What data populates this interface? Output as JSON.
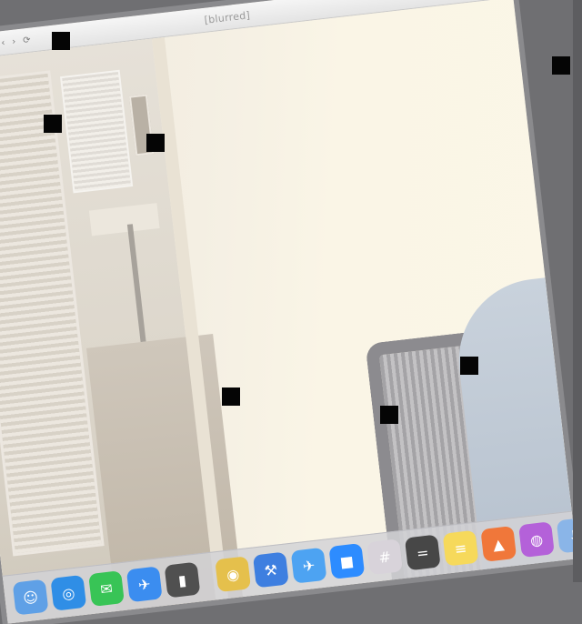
{
  "window": {
    "title": "[blurred]",
    "controls": [
      "‹",
      "›",
      "⟳"
    ]
  },
  "dock": {
    "items": [
      {
        "name": "finder-icon",
        "glyph": "☺",
        "color": "#5fa0e6"
      },
      {
        "name": "safari-icon",
        "glyph": "◎",
        "color": "#2f8ee6"
      },
      {
        "name": "messages-icon",
        "glyph": "✉",
        "color": "#38c456"
      },
      {
        "name": "mail-icon",
        "glyph": "✈",
        "color": "#3b8df0"
      },
      {
        "name": "terminal-icon",
        "glyph": "▮",
        "color": "#505050"
      },
      {
        "name": "chrome-icon",
        "glyph": "◉",
        "color": "#e5c04c"
      },
      {
        "name": "xcode-icon",
        "glyph": "⚒",
        "color": "#3e7fe0"
      },
      {
        "name": "testflight-icon",
        "glyph": "✈",
        "color": "#4da3f2"
      },
      {
        "name": "zoom-icon",
        "glyph": "■",
        "color": "#2d8cff"
      },
      {
        "name": "slack-icon",
        "glyph": "#",
        "color": "#d8d3da"
      },
      {
        "name": "calculator-icon",
        "glyph": "=",
        "color": "#474747"
      },
      {
        "name": "notes-icon",
        "glyph": "≡",
        "color": "#f6d95b"
      },
      {
        "name": "brave-icon",
        "glyph": "▲",
        "color": "#f0773a"
      },
      {
        "name": "podcasts-icon",
        "glyph": "◍",
        "color": "#b461d9"
      },
      {
        "name": "downloads-icon",
        "glyph": "⬇",
        "color": "#8ab5e8"
      }
    ]
  }
}
